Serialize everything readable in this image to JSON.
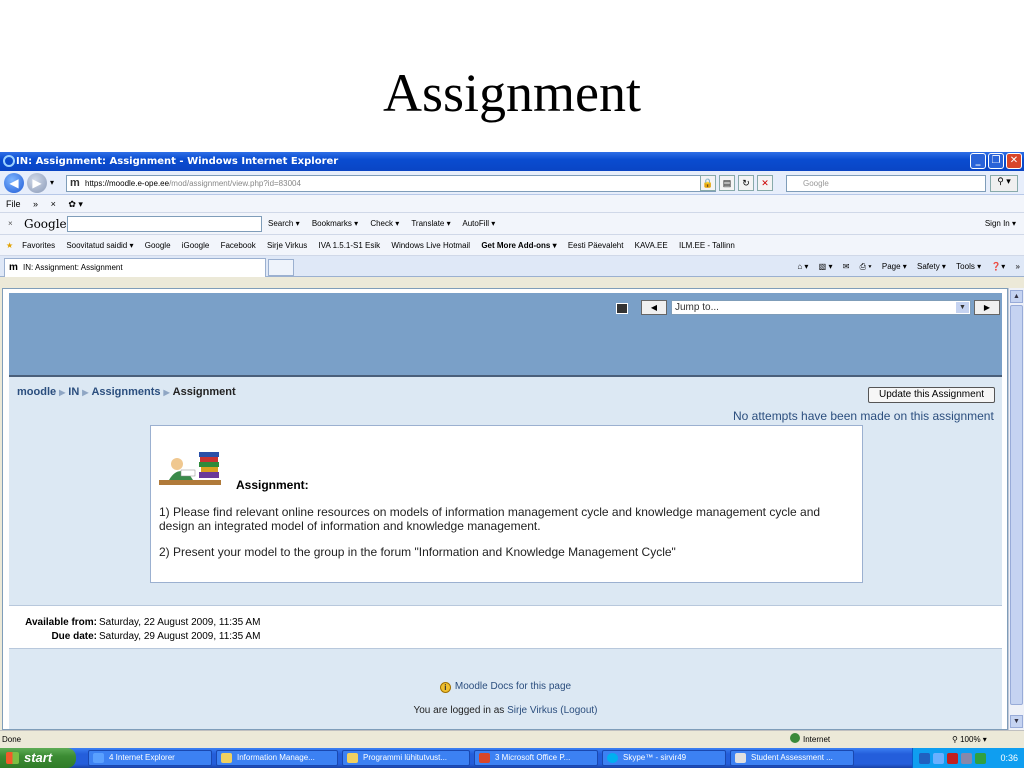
{
  "slide": {
    "title": "Assignment"
  },
  "window": {
    "title": "IN: Assignment: Assignment - Windows Internet Explorer",
    "address_scheme": "https://",
    "address_host": "moodle.e-ope.ee",
    "address_path": "/mod/assignment/view.php?id=83004",
    "search_placeholder": "Google"
  },
  "menubar": {
    "file": "File",
    "more": "»",
    "close": "×"
  },
  "googlebar": {
    "close": "×",
    "logo": "Google",
    "items": [
      "Search ▾",
      "Bookmarks ▾",
      "Check ▾",
      "Translate ▾",
      "AutoFill ▾"
    ],
    "signin": "Sign In ▾"
  },
  "favorites": {
    "label": "Favorites",
    "items": [
      "Soovitatud saidid ▾",
      "Google",
      "iGoogle",
      "Facebook",
      "Sirje Virkus",
      "IVA 1.5.1-S1 Esik",
      "Windows Live Hotmail",
      "Get More Add-ons ▾",
      "Eesti Päevaleht",
      "KAVA.EE",
      "ILM.EE - Tallinn"
    ]
  },
  "tabbar": {
    "tab_title": "IN: Assignment: Assignment",
    "commands": [
      "Page ▾",
      "Safety ▾",
      "Tools ▾"
    ]
  },
  "moodle": {
    "jump_to": "Jump to...",
    "breadcrumb": [
      "moodle",
      "IN",
      "Assignments",
      "Assignment"
    ],
    "update_button": "Update this Assignment",
    "no_attempts": "No attempts have been made on this assignment",
    "intro_heading": "Assignment:",
    "intro_p1": "1) Please find relevant online resources on models of information management cycle and knowledge management cycle and design an integrated model of information and knowledge management.",
    "intro_p2": "2) Present your model to the group in the forum \"Information and Knowledge Management Cycle\"",
    "available_label": "Available from:",
    "available_value": "Saturday, 22 August 2009, 11:35 AM",
    "due_label": "Due date:",
    "due_value": "Saturday, 29 August 2009, 11:35 AM",
    "docs_link": "Moodle Docs for this page",
    "logged_prefix": "You are logged in as",
    "user_name": "Sirje Virkus",
    "logout": "(Logout)"
  },
  "statusbar": {
    "text": "Done",
    "zone": "Internet",
    "zoom": "100%"
  },
  "taskbar": {
    "start": "start",
    "tasks": [
      "4 Internet Explorer",
      "Information Manage...",
      "Programmi lühitutvust...",
      "3 Microsoft Office P...",
      "Skype™ - sirvir49",
      "Student Assessment ..."
    ],
    "clock": "0:36"
  },
  "colors": {
    "ie_titlebar": "#0a4cd0",
    "moodle_header": "#7aa0c8",
    "moodle_body": "#dce8f3",
    "link": "#2b4e7e",
    "taskbar": "#245edb",
    "start_button": "#3c8c34"
  }
}
